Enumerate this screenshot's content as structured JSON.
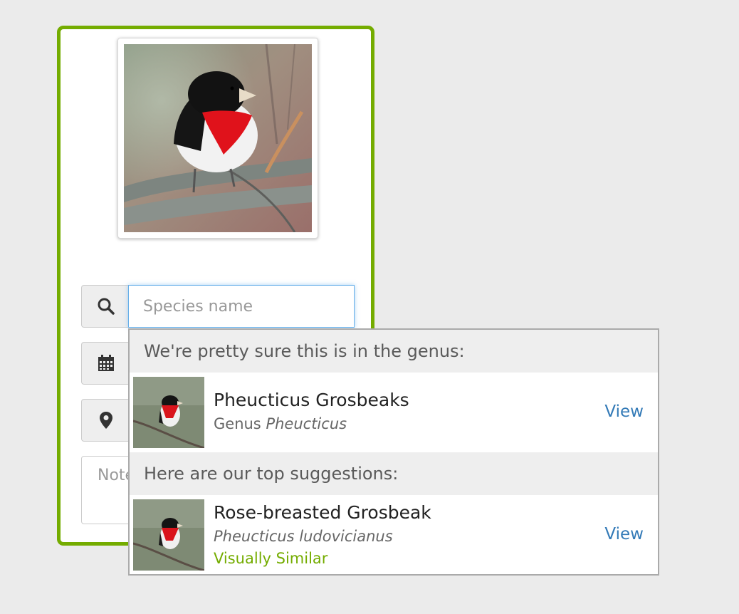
{
  "colors": {
    "accent_green": "#74ac00",
    "link_blue": "#337ab7",
    "focus_blue": "#66afe9"
  },
  "form": {
    "species_placeholder": "Species name",
    "notes_placeholder": "Notes",
    "icons": [
      "search-icon",
      "calendar-icon",
      "location-pin-icon"
    ]
  },
  "suggestions": {
    "genus_header": "We're pretty sure this is in the genus:",
    "genus_result": {
      "name": "Pheucticus Grosbeaks",
      "rank": "Genus",
      "scientific_name": "Pheucticus",
      "view_label": "View"
    },
    "top_header": "Here are our top suggestions:",
    "top_result": {
      "name": "Rose-breasted Grosbeak",
      "scientific_name": "Pheucticus ludovicianus",
      "tag": "Visually Similar",
      "view_label": "View"
    }
  }
}
